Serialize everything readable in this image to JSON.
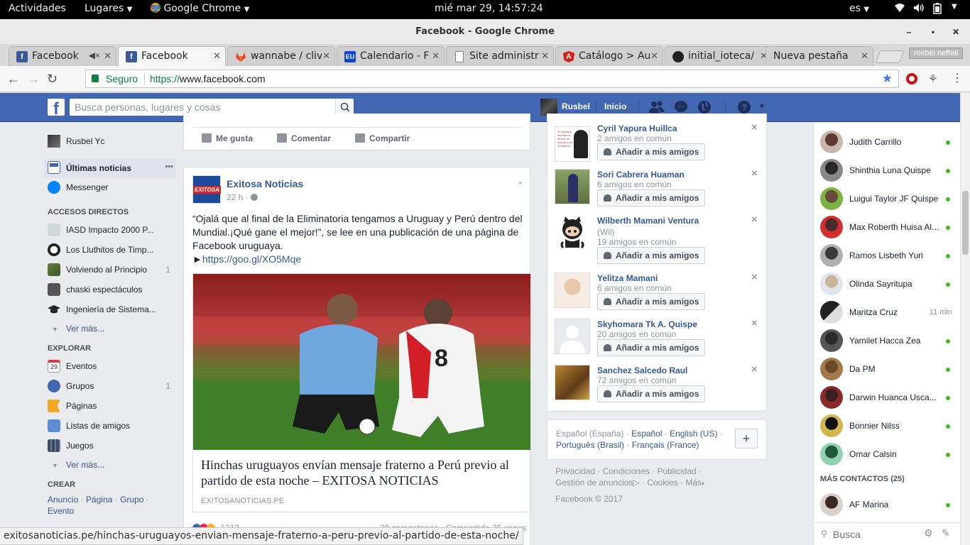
{
  "system": {
    "activities": "Actividades",
    "places": "Lugares",
    "app": "Google Chrome",
    "clock": "mié mar 29, 14:57:24",
    "lang": "es"
  },
  "window": {
    "title": "Facebook - Google Chrome"
  },
  "tabs": [
    {
      "label": "Facebook",
      "favicon": "facebook-icon",
      "color": "#3b5998"
    },
    {
      "label": "Facebook",
      "favicon": "facebook-icon",
      "color": "#3b5998"
    },
    {
      "label": "wannabe / cliv",
      "favicon": "gitlab-icon",
      "color": "#e24329"
    },
    {
      "label": "Calendario - F",
      "favicon": "eu-icon",
      "color": "#0e47cb"
    },
    {
      "label": "Site administr",
      "favicon": "document-icon",
      "color": "#888888"
    },
    {
      "label": "Catálogo > Au",
      "favicon": "angular-icon",
      "color": "#dd1b16"
    },
    {
      "label": "initial_ioteca/",
      "favicon": "github-icon",
      "color": "#222222"
    },
    {
      "label": "Nueva pestaña",
      "favicon": "",
      "color": ""
    }
  ],
  "profile": "rosbel neftali",
  "address": {
    "secure_label": "Seguro",
    "scheme": "https://",
    "host": "www.facebook.com"
  },
  "fb": {
    "search_placeholder": "Busca personas, lugares y cosas",
    "user": "Rusbel",
    "home": "Inicio"
  },
  "left": {
    "profile_name": "Rusbel Yc",
    "news_feed": "Últimas noticias",
    "news_feed_more": "•••",
    "messenger": "Messenger",
    "shortcuts_heading": "ACCESOS DIRECTOS",
    "shortcuts": [
      {
        "label": "IASD Impacto 2000 P...",
        "count": ""
      },
      {
        "label": "Los Lluthitos de Timp...",
        "count": ""
      },
      {
        "label": "Volviendo al Principio",
        "count": "1"
      },
      {
        "label": "chaski espectáculos",
        "count": ""
      },
      {
        "label": "Ingeniería de Sistema...",
        "count": ""
      }
    ],
    "see_more_1": "Ver más...",
    "explore_heading": "EXPLORAR",
    "explore": [
      {
        "label": "Eventos",
        "count": ""
      },
      {
        "label": "Grupos",
        "count": "1"
      },
      {
        "label": "Páginas",
        "count": ""
      },
      {
        "label": "Listas de amigos",
        "count": ""
      },
      {
        "label": "Juegos",
        "count": ""
      }
    ],
    "calendar_day": "29",
    "see_more_2": "Ver más...",
    "create_heading": "CREAR",
    "create_links": [
      "Anuncio",
      "Página",
      "Grupo",
      "Evento"
    ]
  },
  "feed": {
    "actions": [
      "Me gusta",
      "Comentar",
      "Compartir"
    ],
    "post": {
      "author": "Exitosa Noticias",
      "logo_text": "EXITOSA",
      "time": "22 h",
      "text": "“Ojalá que al final de la Eliminatoria tengamos a Uruguay y Perú dentro del Mundial.¡Qué gane el mejor!”, se lee en una publicación de una página de Facebook uruguaya.",
      "link_prefix": "►",
      "link": "https://goo.gl/XO5Mqe",
      "article_title": "Hinchas uruguayos envían mensaje fraterno a Perú previo al partido de esta noche – EXITOSA NOTICIAS",
      "article_source": "EXITOSANOTICIAS.PE",
      "jersey_number": "8",
      "stats": {
        "reactions": "1213",
        "comments": "29 comentarios",
        "shares": "Compartido 26 veces"
      }
    }
  },
  "suggestions": {
    "add_label": "Añadir a mis amigos",
    "people": [
      {
        "name": "Cyril Yapura Huillca",
        "detail": "",
        "mutual": "2 amigos en común"
      },
      {
        "name": "Sori Cabrera Huaman",
        "detail": "",
        "mutual": "6 amigos en común"
      },
      {
        "name": "Wilberth Mamani Ventura",
        "detail": "(Wil)",
        "mutual": "19 amigos en común"
      },
      {
        "name": "Yelitza Mamani",
        "detail": "",
        "mutual": "6 amigos en común"
      },
      {
        "name": "Skyhomara Tk A. Quispe",
        "detail": "",
        "mutual": "20 amigos en común"
      },
      {
        "name": "Sanchez Salcedo Raul",
        "detail": "",
        "mutual": "72 amigos en común"
      }
    ],
    "thumb_text": "El malvado verdadero muere de espiritu y de la relacion"
  },
  "languages": {
    "current": "Español (España)",
    "others": [
      "Español",
      "English (US)",
      "Português (Brasil)",
      "Français (France)"
    ],
    "plus": "+"
  },
  "footer": {
    "links": [
      "Privacidad",
      "Condiciones",
      "Publicidad",
      "Gestión de anuncios",
      "Cookies",
      "Más"
    ],
    "copyright": "Facebook © 2017"
  },
  "chat": {
    "contacts": [
      {
        "name": "Judith Carrillo",
        "status": "online",
        "time": ""
      },
      {
        "name": "Shinthia Luna Quispe",
        "status": "online",
        "time": ""
      },
      {
        "name": "Luigui Taylor JF Quispe",
        "status": "online",
        "time": ""
      },
      {
        "name": "Max Roberth Huisa Al...",
        "status": "online",
        "time": ""
      },
      {
        "name": "Ramos Lisbeth Yuri",
        "status": "online",
        "time": ""
      },
      {
        "name": "Olinda Sayritupa",
        "status": "online",
        "time": ""
      },
      {
        "name": "Maritza Cruz",
        "status": "idle",
        "time": "11 min"
      },
      {
        "name": "Yamilet Hacca Zea",
        "status": "online",
        "time": ""
      },
      {
        "name": "Da PM",
        "status": "online",
        "time": ""
      },
      {
        "name": "Darwin Huanca Usca...",
        "status": "online",
        "time": ""
      },
      {
        "name": "Bonnier Nilss",
        "status": "online",
        "time": ""
      },
      {
        "name": "Omar Calsin",
        "status": "online",
        "time": ""
      }
    ],
    "more_heading": "MÁS CONTACTOS (25)",
    "more": [
      {
        "name": "AF Marina",
        "status": "online"
      }
    ],
    "search_placeholder": "Busca"
  },
  "status_url": "exitosanoticias.pe/hinchas-uruguayos-envian-mensaje-fraterno-a-peru-previo-al-partido-de-esta-noche/"
}
